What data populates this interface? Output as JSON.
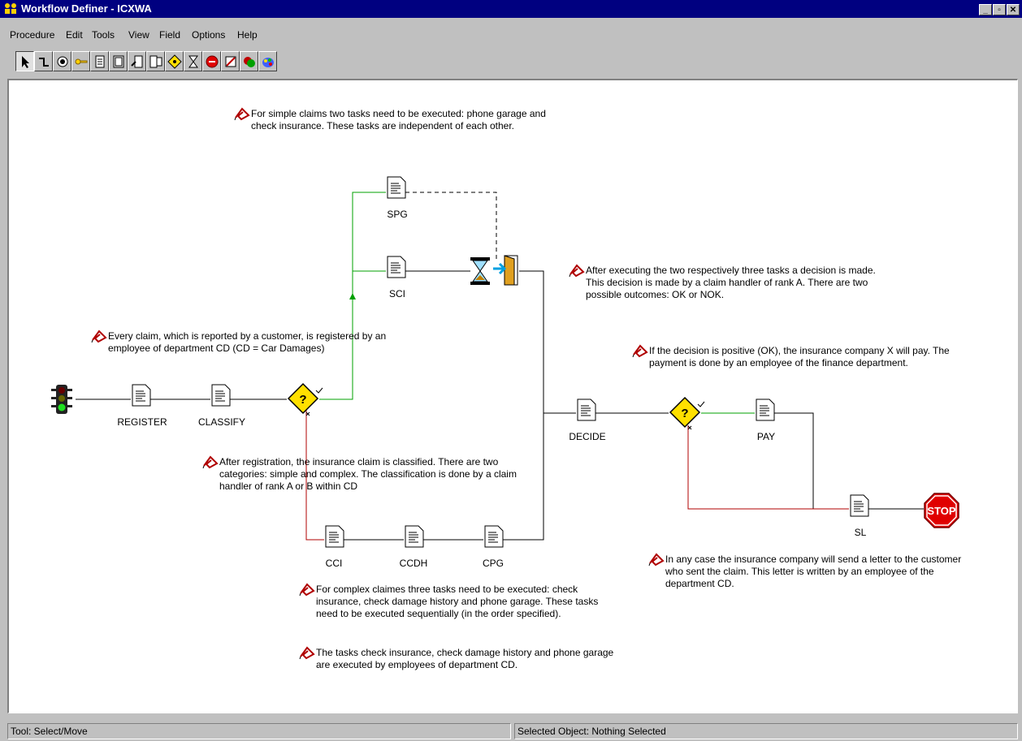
{
  "window": {
    "title": "Workflow Definer - ICXWA"
  },
  "menu": [
    "Procedure",
    "Edit",
    "Tools",
    "View",
    "Field",
    "Options",
    "Help"
  ],
  "toolbar": {
    "tools": [
      "select-icon",
      "connector-icon",
      "start-node-icon",
      "key-icon",
      "task-icon",
      "subprocess-icon",
      "task-edit-icon",
      "task-list-icon",
      "decision-icon",
      "hourglass-icon",
      "stop-icon",
      "note-icon",
      "routing-icon",
      "color-palette-icon"
    ]
  },
  "nodes": {
    "register": "REGISTER",
    "classify": "CLASSIFY",
    "spg": "SPG",
    "sci": "SCI",
    "cci": "CCI",
    "ccdh": "CCDH",
    "cpg": "CPG",
    "decide": "DECIDE",
    "pay": "PAY",
    "sl": "SL",
    "stop": "STOP"
  },
  "notes": {
    "simple": "For simple claims two tasks need to be executed: phone garage and\ncheck insurance. These tasks are independent of each other.",
    "decision": "After executing the two respectively three tasks a decision is made.\nThis decision is made by a claim handler of rank A. There are two\npossible outcomes: OK or NOK.",
    "every": "Every claim, which is reported by a customer, is registered by an\nemployee of department CD (CD = Car Damages)",
    "positive": "If the decision is positive (OK), the insurance company X will pay. The\npayment is done by an employee of the finance department.",
    "registration": "After registration, the insurance claim is classified. There are two\ncategories: simple and complex. The classification is done by a claim\nhandler of rank A or B within CD",
    "letter": "In any case the insurance company will send a letter to the customer\nwho sent the claim. This letter is written by an employee of the\ndepartment CD.",
    "complex": "For complex claimes three tasks need to be executed: check\ninsurance, check damage history and phone garage. These tasks\nneed to be executed sequentially (in the order specified).",
    "tasks": "The tasks check insurance, check damage history and phone garage\nare executed by employees of department CD."
  },
  "status": {
    "tool": "Tool: Select/Move",
    "selected": "Selected Object: Nothing Selected"
  },
  "colors": {
    "titlebar": "#000080",
    "green_flow": "#00a000",
    "red_flow": "#b00000",
    "stop": "#e00000",
    "decision": "#ffe000"
  }
}
